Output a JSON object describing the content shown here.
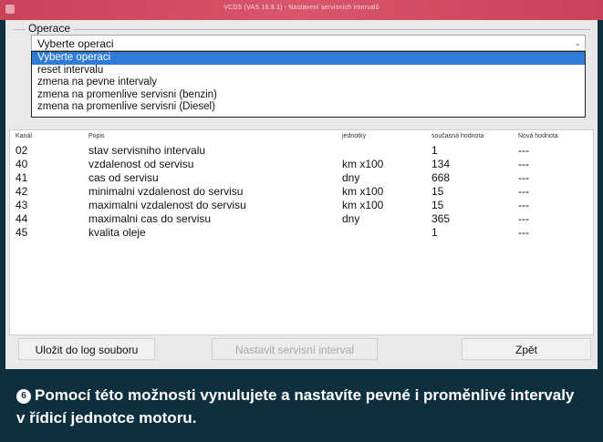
{
  "window": {
    "title": "VCDS (VAS 18.8.1) - Nastavení servisních intervalů"
  },
  "group": {
    "label": "Operace"
  },
  "select": {
    "value": "Vyberte operaci",
    "chevron": "⌄",
    "options": [
      "Vyberte operaci",
      "reset intervalu",
      "zmena na pevne intervaly",
      "zmena na promenlive servisni (benzin)",
      "zmena na promenlive servisni (Diesel)"
    ],
    "selected_index": 0
  },
  "table": {
    "headers": {
      "kanal": "Kanál",
      "popis": "Popis",
      "jednotky": "jednotky",
      "soucasna": "současná hodnota",
      "nova": "Nová hodnota"
    },
    "rows": [
      {
        "kanal": "02",
        "popis": "stav servisniho intervalu",
        "jednotky": "",
        "soucasna": "1",
        "nova": "---"
      },
      {
        "kanal": "40",
        "popis": "vzdalenost od servisu",
        "jednotky": "km x100",
        "soucasna": "134",
        "nova": "---"
      },
      {
        "kanal": "41",
        "popis": "cas od servisu",
        "jednotky": "dny",
        "soucasna": "668",
        "nova": "---"
      },
      {
        "kanal": "42",
        "popis": "minimalni vzdalenost do servisu",
        "jednotky": "km x100",
        "soucasna": "15",
        "nova": "---"
      },
      {
        "kanal": "43",
        "popis": "maximalni vzdalenost do servisu",
        "jednotky": "km x100",
        "soucasna": "15",
        "nova": "---"
      },
      {
        "kanal": "44",
        "popis": "maximalni cas do servisu",
        "jednotky": "dny",
        "soucasna": "365",
        "nova": "---"
      },
      {
        "kanal": "45",
        "popis": "kvalita oleje",
        "jednotky": "",
        "soucasna": "1",
        "nova": "---"
      }
    ]
  },
  "buttons": {
    "save_log": "Uložit do log souboru",
    "set_interval": "Nastavit servisní interval",
    "back": "Zpět"
  },
  "caption": {
    "badge": "6",
    "text": "Pomocí této možnosti vynulujete a nastavíte pevné i proměnlivé intervaly v řídicí jednotce motoru."
  },
  "colors": {
    "titlebar": "#c8425a",
    "selection": "#2f7bd8",
    "caption_bg": "#0e2f3d"
  }
}
